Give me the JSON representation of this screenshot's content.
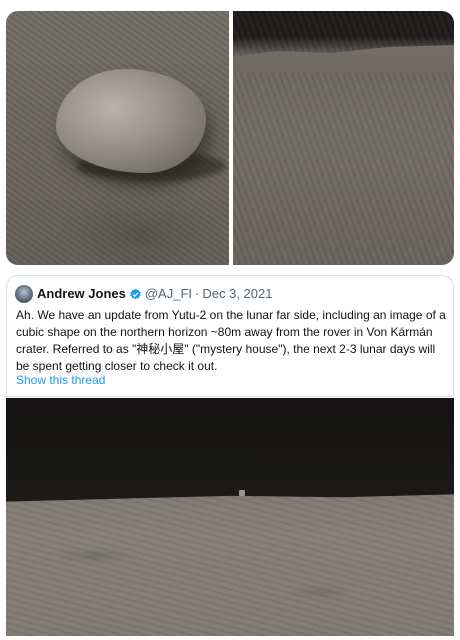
{
  "tweet": {
    "author_name": "Andrew Jones",
    "handle": "@AJ_FI",
    "separator": "·",
    "date": "Dec 3, 2021",
    "text": "Ah. We have an update from Yutu-2 on the lunar far side, including an image of a cubic shape on the northern horizon ~80m away from the rover in Von Kármán crater. Referred to as \"神秘小屋\" (\"mystery house\"), the next 2-3 lunar days will be spent getting closer to check it out.",
    "show_thread": "Show this thread"
  },
  "colors": {
    "link": "#1d9bf0",
    "verified_badge": "#1d9bf0",
    "text_primary": "#0f1419",
    "text_secondary": "#536471"
  },
  "icons": {
    "verified": "verified-badge-icon",
    "avatar": "avatar-image"
  }
}
